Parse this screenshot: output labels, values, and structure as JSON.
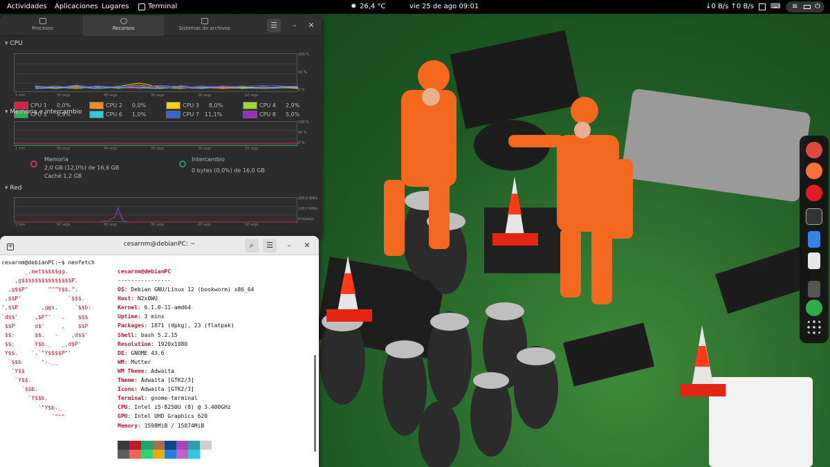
{
  "topbar": {
    "activities": "Actividades",
    "apps": "Aplicaciones",
    "places": "Lugares",
    "terminal": "Terminal",
    "weather": "26,4 °C",
    "clock": "vie 25 de ago  09:01",
    "net": "↓0 B/s ↑0 B/s"
  },
  "sysmon": {
    "tabs": [
      {
        "label": "Procesos"
      },
      {
        "label": "Recursos"
      },
      {
        "label": "Sistemas de archivos"
      }
    ],
    "cpu_title": "CPU",
    "mem_title": "Memoria e intercambio",
    "net_title": "Red",
    "pct_ticks": [
      "100 %",
      "50 %",
      "0 %"
    ],
    "net_ticks": [
      "200,0 KiB/s",
      "100,0 KiB/s",
      "0 bytes/s"
    ],
    "x_ticks": [
      "1 min",
      "50 segs",
      "40 segs",
      "30 segs",
      "20 segs",
      "10 segs"
    ],
    "cpus": [
      {
        "label": "CPU 1",
        "value": "0,0%",
        "color": "#e01b4c"
      },
      {
        "label": "CPU 2",
        "value": "0,0%",
        "color": "#f08b2a"
      },
      {
        "label": "CPU 3",
        "value": "8,0%",
        "color": "#f5d20c"
      },
      {
        "label": "CPU 4",
        "value": "2,9%",
        "color": "#a3d631"
      },
      {
        "label": "CPU 5",
        "value": "9,9%",
        "color": "#2fac4f"
      },
      {
        "label": "CPU 6",
        "value": "1,0%",
        "color": "#33c7de"
      },
      {
        "label": "CPU 7",
        "value": "11,1%",
        "color": "#3b5fd8"
      },
      {
        "label": "CPU 8",
        "value": "5,0%",
        "color": "#9a2fbd"
      }
    ],
    "memory": {
      "label": "Memoria",
      "value": "2,0 GB (12,0%) de 16,6 GB",
      "cache": "Caché 1,2 GB"
    },
    "swap": {
      "label": "Intercambio",
      "value": "0 bytes (0,0%) de 16,0 GB"
    }
  },
  "terminal": {
    "title": "cesarnm@debianPC: ~",
    "prompt": "cesarnm@debianPC:~$ neofetch",
    "logo": [
      "       _,met$$$$$gg.",
      "    ,g$$$$$$$$$$$$$$$P.",
      "  ,g$$P\"      \"\"\"Y$$.\".",
      " ,$$P'              `$$$.",
      "',$$P       ,ggs.     `$$b:",
      "`d$$'     ,$P\"'   .    $$$",
      " $$P      d$'     ,    $$P",
      " $$:      $$.   -    ,d$$'",
      " $$;      Y$b._   _,d$P'",
      " Y$$.    `.`\"Y$$$$P\"'",
      "  `$$b      \"-.__",
      "   `Y$$",
      "    `Y$$.",
      "      `$$b.",
      "        `Y$$b.",
      "           `\"Y$b._",
      "               `\"\"\""
    ],
    "user_host": "cesarnm@debianPC",
    "sep": "----------------",
    "info": [
      {
        "k": "OS",
        "v": "Debian GNU/Linux 12 (bookworm) x86_64"
      },
      {
        "k": "Host",
        "v": "N2x0WU"
      },
      {
        "k": "Kernel",
        "v": "6.1.0-11-amd64"
      },
      {
        "k": "Uptime",
        "v": "3 mins"
      },
      {
        "k": "Packages",
        "v": "1871 (dpkg), 23 (flatpak)"
      },
      {
        "k": "Shell",
        "v": "bash 5.2.15"
      },
      {
        "k": "Resolution",
        "v": "1920x1080"
      },
      {
        "k": "DE",
        "v": "GNOME 43.6"
      },
      {
        "k": "WM",
        "v": "Mutter"
      },
      {
        "k": "WM Theme",
        "v": "Adwaita"
      },
      {
        "k": "Theme",
        "v": "Adwaita [GTK2/3]"
      },
      {
        "k": "Icons",
        "v": "Adwaita [GTK2/3]"
      },
      {
        "k": "Terminal",
        "v": "gnome-terminal"
      },
      {
        "k": "CPU",
        "v": "Intel i5-8250U (8) @ 3.400GHz"
      },
      {
        "k": "GPU",
        "v": "Intel UHD Graphics 620"
      },
      {
        "k": "Memory",
        "v": "1598MiB / 15874MiB"
      }
    ],
    "palette": [
      "#3a3a3a",
      "#c01c28",
      "#26a269",
      "#a2734c",
      "#12488b",
      "#a347ba",
      "#2aa1b3",
      "#d0cfcc",
      "#5e5c64",
      "#f66151",
      "#33d17a",
      "#e9ad0c",
      "#2a7bde",
      "#c061cb",
      "#33c7de",
      "#ffffff"
    ]
  },
  "dock": {
    "apps": [
      {
        "icon": "chrome-icon",
        "color": "#dd4b3e"
      },
      {
        "icon": "firefox-icon",
        "color": "#ff7139"
      },
      {
        "icon": "media-player-icon",
        "color": "#e01b24"
      },
      {
        "icon": "terminal-icon",
        "color": "#333333"
      },
      {
        "icon": "notes-icon",
        "color": "#3584e4"
      },
      {
        "icon": "software-icon",
        "color": "#e8e8e8"
      },
      {
        "icon": "system-monitor-icon",
        "color": "#555555"
      },
      {
        "icon": "trash-icon",
        "color": "#2fac4f"
      },
      {
        "icon": "app-grid-icon",
        "color": "#dddddd"
      }
    ]
  }
}
